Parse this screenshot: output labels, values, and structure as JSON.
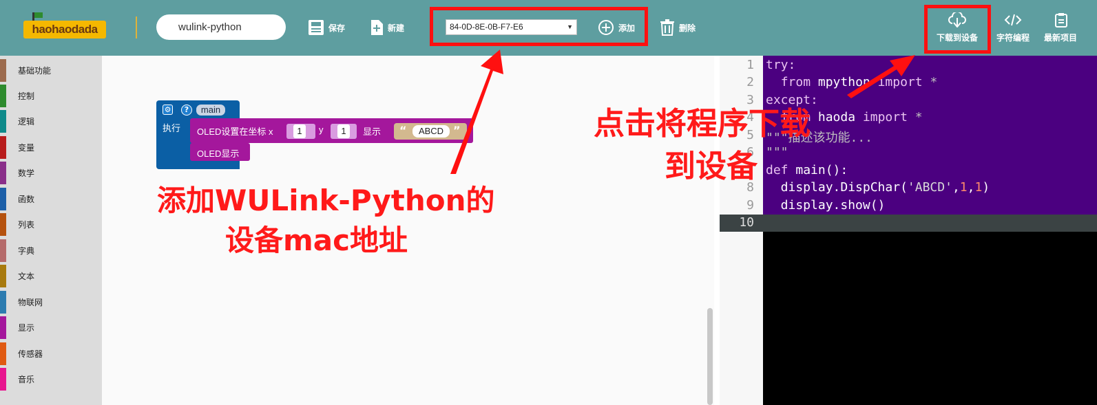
{
  "header": {
    "logo_text": "haohaodada",
    "logo_sub": "",
    "project_name": "wulink-python",
    "save_label": "保存",
    "new_label": "新建",
    "device_mac": "84-0D-8E-0B-F7-E6",
    "add_label": "添加",
    "delete_label": "删除",
    "download_label": "下载到设备",
    "code_label": "字符编程",
    "recent_label": "最新项目"
  },
  "sidebar": {
    "items": [
      {
        "label": "基础功能",
        "color": "#9c6b4e"
      },
      {
        "label": "控制",
        "color": "#2e8b2e"
      },
      {
        "label": "逻辑",
        "color": "#0e8a8a"
      },
      {
        "label": "变量",
        "color": "#b81c1c"
      },
      {
        "label": "数学",
        "color": "#8a2f8a"
      },
      {
        "label": "函数",
        "color": "#1c5fa8"
      },
      {
        "label": "列表",
        "color": "#b5520e"
      },
      {
        "label": "字典",
        "color": "#b56b6b"
      },
      {
        "label": "文本",
        "color": "#a87a0e"
      },
      {
        "label": "物联网",
        "color": "#2d7cb0"
      },
      {
        "label": "显示",
        "color": "#a4179c"
      },
      {
        "label": "传感器",
        "color": "#e05a12"
      },
      {
        "label": "音乐",
        "color": "#e8158f"
      }
    ]
  },
  "blocks": {
    "func_name": "main",
    "exec_label": "执行",
    "oled_pos_label": "OLED设置在坐标 x",
    "x_value": "1",
    "y_label": "y",
    "y_value": "1",
    "show_label": "显示",
    "text_value": "ABCD",
    "oled_show_label": "OLED显示"
  },
  "code": {
    "line_numbers": [
      "1",
      "2",
      "3",
      "4",
      "5",
      "6",
      "7",
      "8",
      "9",
      "10"
    ]
  },
  "annotations": {
    "mac_line1": "添加WULink-Python的",
    "mac_line2": "设备mac地址",
    "dl_line1": "点击将程序下载",
    "dl_line2": "到设备"
  }
}
